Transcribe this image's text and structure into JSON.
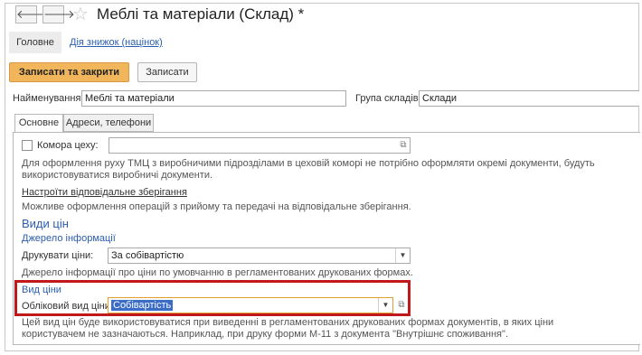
{
  "window": {
    "title": "Меблі та матеріали (Склад) *",
    "back_glyph": "🡐",
    "forward_glyph": "🡒",
    "star_glyph": "☆"
  },
  "commands": {
    "main_label": "Головне",
    "discounts_link": "Дія знижок (націнок)"
  },
  "toolbar": {
    "save_close_label": "Записати та закрити",
    "save_label": "Записати"
  },
  "header_fields": {
    "name_label": "Найменування:",
    "name_value": "Меблі та матеріали",
    "group_label": "Група складів:",
    "group_value": "Склади"
  },
  "tabs": [
    {
      "label": "Основне"
    },
    {
      "label": "Адреси, телефони"
    }
  ],
  "main": {
    "storeroom_label": "Комора цеху:",
    "storeroom_value": "",
    "storeroom_note": "Для оформлення руху ТМЦ з виробничими підрозділами в цеховій коморі не потрібно оформляти окремі документи, будуть використовуватися виробничі документи.",
    "custody_link": "Настроїти відповідальне зберігання",
    "custody_note": "Можливе оформлення операцій з прийому та передачі на відповідальне зберігання.",
    "prices_heading": "Види цін",
    "info_source_heading": "Джерело інформації",
    "print_prices_label": "Друкувати ціни:",
    "print_prices_value": "За собівартістю",
    "print_prices_note": "Джерело інформації про ціни по умовчанню в регламентованих друкованих формах.",
    "price_type_heading": "Вид ціни",
    "accounting_price_label": "Обліковий вид ціни:",
    "accounting_price_value": "Собівартість",
    "price_type_note": "Цей вид цін буде використовуватися при виведенні в регламентованих друкованих формах документів, в яких ціни користувачем не зазначаються. Наприклад, при друку форми М-11 з документа \"Внутрішнє споживання\"."
  },
  "colors": {
    "accent_button": "#f1b65c",
    "link": "#2a5db0",
    "highlight_border": "#c0181b",
    "selection": "#3b6cc6"
  }
}
